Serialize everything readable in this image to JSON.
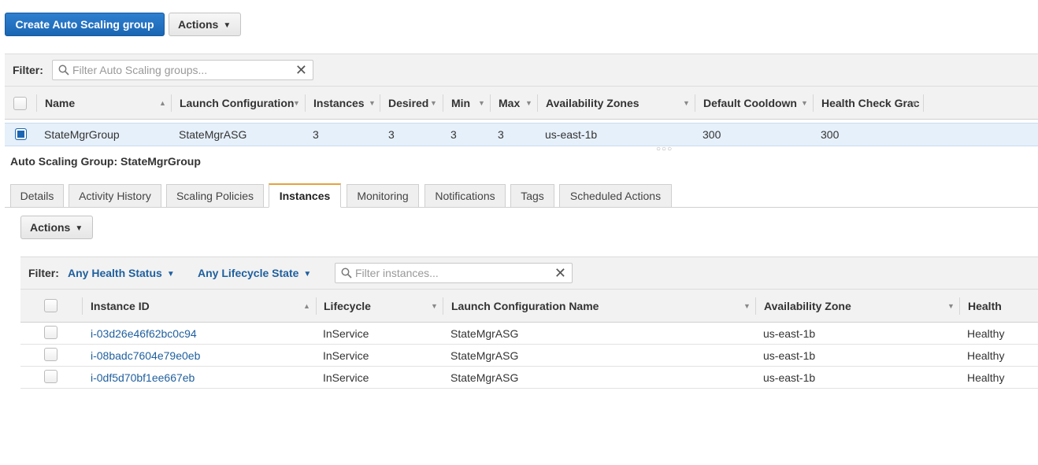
{
  "toolbar": {
    "create_label": "Create Auto Scaling group",
    "actions_label": "Actions"
  },
  "group_filter": {
    "label": "Filter:",
    "placeholder": "Filter Auto Scaling groups..."
  },
  "groups_table": {
    "columns": [
      "Name",
      "Launch Configuration",
      "Instances",
      "Desired",
      "Min",
      "Max",
      "Availability Zones",
      "Default Cooldown",
      "Health Check Grac"
    ],
    "rows": [
      {
        "selected": true,
        "name": "StateMgrGroup",
        "launch_configuration": "StateMgrASG",
        "instances": "3",
        "desired": "3",
        "min": "3",
        "max": "3",
        "availability_zones": "us-east-1b",
        "default_cooldown": "300",
        "health_check_grace": "300"
      }
    ]
  },
  "details": {
    "title": "Auto Scaling Group: StateMgrGroup",
    "tabs": [
      "Details",
      "Activity History",
      "Scaling Policies",
      "Instances",
      "Monitoring",
      "Notifications",
      "Tags",
      "Scheduled Actions"
    ],
    "active_tab": "Instances",
    "actions_label": "Actions"
  },
  "instance_filter": {
    "label": "Filter:",
    "health_status": "Any Health Status",
    "lifecycle_state": "Any Lifecycle State",
    "placeholder": "Filter instances..."
  },
  "instances_table": {
    "columns": [
      "Instance ID",
      "Lifecycle",
      "Launch Configuration Name",
      "Availability Zone",
      "Health Status"
    ],
    "rows": [
      {
        "instance_id": "i-03d26e46f62bc0c94",
        "lifecycle": "InService",
        "launch_configuration_name": "StateMgrASG",
        "availability_zone": "us-east-1b",
        "health_status": "Healthy"
      },
      {
        "instance_id": "i-08badc7604e79e0eb",
        "lifecycle": "InService",
        "launch_configuration_name": "StateMgrASG",
        "availability_zone": "us-east-1b",
        "health_status": "Healthy"
      },
      {
        "instance_id": "i-0df5d70bf1ee667eb",
        "lifecycle": "InService",
        "launch_configuration_name": "StateMgrASG",
        "availability_zone": "us-east-1b",
        "health_status": "Healthy"
      }
    ]
  },
  "colors": {
    "primary": "#1b66b3",
    "link": "#1f5f9e",
    "active_tab_accent": "#e7a23c",
    "selected_row": "#e6f0fa"
  }
}
